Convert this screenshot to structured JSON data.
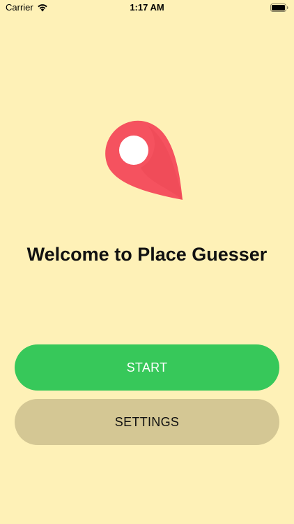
{
  "status_bar": {
    "carrier": "Carrier",
    "time": "1:17 AM",
    "icons": [
      "wifi-icon",
      "battery-icon"
    ]
  },
  "welcome": {
    "title": "Welcome to Place Guesser",
    "icon": "map-pin-icon"
  },
  "buttons": {
    "start_label": "START",
    "settings_label": "SETTINGS"
  },
  "colors": {
    "background": "#FEF1B7",
    "pin": "#F5525F",
    "start_button": "#37C85A",
    "settings_button": "#D4C794"
  }
}
